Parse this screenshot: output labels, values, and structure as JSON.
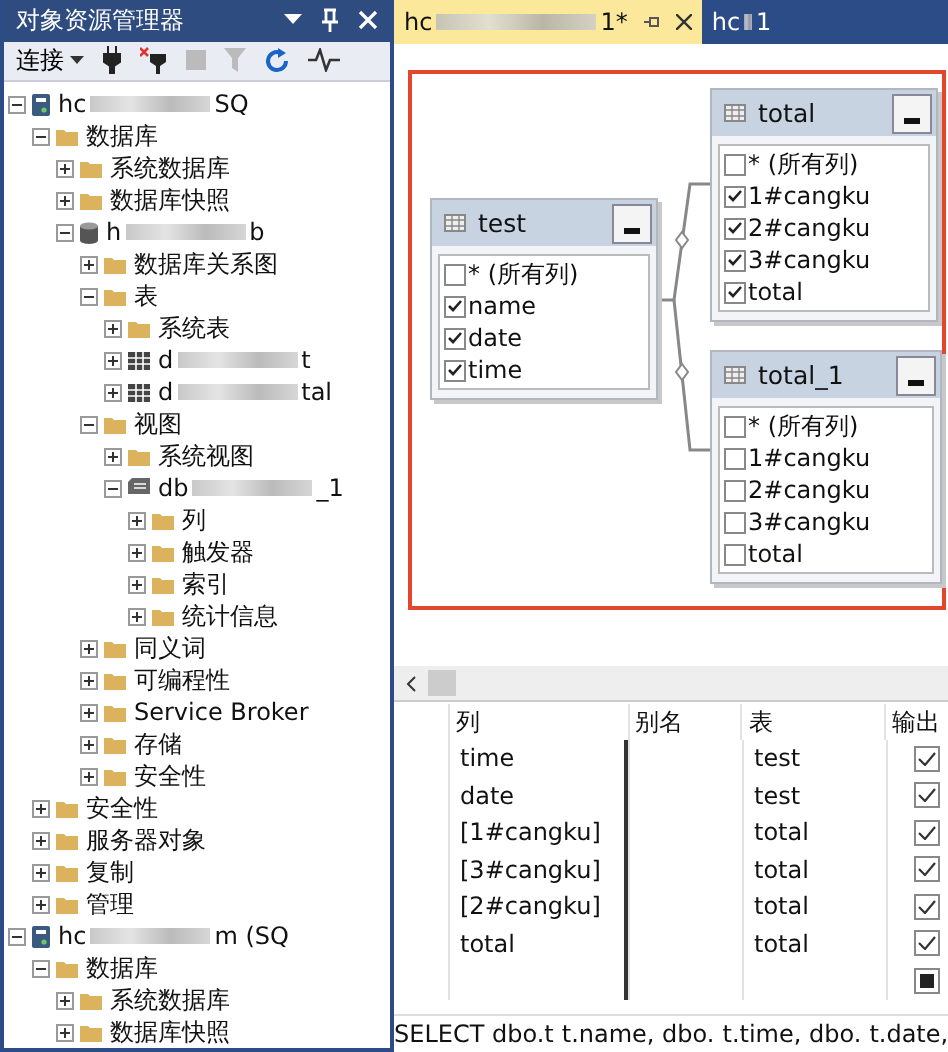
{
  "explorer": {
    "title": "对象资源管理器",
    "connect_label": "连接"
  },
  "tree": [
    {
      "kind": "server",
      "label": "hc",
      "redacted": true,
      "suffix": "SQ",
      "expanded": true,
      "children": [
        {
          "kind": "folder",
          "label": "数据库",
          "expanded": true,
          "children": [
            {
              "kind": "folder",
              "label": "系统数据库",
              "expanded": false
            },
            {
              "kind": "folder",
              "label": "数据库快照",
              "expanded": false
            },
            {
              "kind": "database",
              "label": "h",
              "redacted": true,
              "suffix": "b",
              "expanded": true,
              "children": [
                {
                  "kind": "folder",
                  "label": "数据库关系图",
                  "expanded": false
                },
                {
                  "kind": "folder",
                  "label": "表",
                  "expanded": true,
                  "children": [
                    {
                      "kind": "folder",
                      "label": "系统表",
                      "expanded": false
                    },
                    {
                      "kind": "table",
                      "label": "d",
                      "redacted": true,
                      "suffix": "t",
                      "expanded": false
                    },
                    {
                      "kind": "table",
                      "label": "d",
                      "redacted": true,
                      "suffix": "tal",
                      "expanded": false
                    }
                  ]
                },
                {
                  "kind": "folder",
                  "label": "视图",
                  "expanded": true,
                  "children": [
                    {
                      "kind": "folder",
                      "label": "系统视图",
                      "expanded": false
                    },
                    {
                      "kind": "view",
                      "label": "db",
                      "redacted": true,
                      "suffix": "_1",
                      "expanded": true,
                      "children": [
                        {
                          "kind": "folder",
                          "label": "列",
                          "expanded": false
                        },
                        {
                          "kind": "folder",
                          "label": "触发器",
                          "expanded": false
                        },
                        {
                          "kind": "folder",
                          "label": "索引",
                          "expanded": false
                        },
                        {
                          "kind": "folder",
                          "label": "统计信息",
                          "expanded": false
                        }
                      ]
                    }
                  ]
                },
                {
                  "kind": "folder",
                  "label": "同义词",
                  "expanded": false
                },
                {
                  "kind": "folder",
                  "label": "可编程性",
                  "expanded": false
                },
                {
                  "kind": "folder",
                  "label": "Service Broker",
                  "expanded": false
                },
                {
                  "kind": "folder",
                  "label": "存储",
                  "expanded": false
                },
                {
                  "kind": "folder",
                  "label": "安全性",
                  "expanded": false
                }
              ]
            }
          ]
        },
        {
          "kind": "folder",
          "label": "安全性",
          "expanded": false
        },
        {
          "kind": "folder",
          "label": "服务器对象",
          "expanded": false
        },
        {
          "kind": "folder",
          "label": "复制",
          "expanded": false
        },
        {
          "kind": "folder",
          "label": "管理",
          "expanded": false
        }
      ]
    },
    {
      "kind": "server",
      "label": "hc",
      "redacted": true,
      "suffix": "m (SQ",
      "expanded": true,
      "children": [
        {
          "kind": "folder",
          "label": "数据库",
          "expanded": true,
          "children": [
            {
              "kind": "folder",
              "label": "系统数据库",
              "expanded": false
            },
            {
              "kind": "folder",
              "label": "数据库快照",
              "expanded": false
            }
          ]
        }
      ]
    }
  ],
  "tabs": [
    {
      "label": "hc",
      "suffix": "1*",
      "selected": true
    },
    {
      "label": "hc",
      "suffix": "1",
      "selected": false
    }
  ],
  "diagram_tables": [
    {
      "name": "test",
      "columns": [
        {
          "name": "* (所有列)",
          "checked": false
        },
        {
          "name": "name",
          "checked": true
        },
        {
          "name": "date",
          "checked": true
        },
        {
          "name": "time",
          "checked": true
        }
      ]
    },
    {
      "name": "total",
      "columns": [
        {
          "name": "* (所有列)",
          "checked": false
        },
        {
          "name": "1#cangku",
          "checked": true
        },
        {
          "name": "2#cangku",
          "checked": true
        },
        {
          "name": "3#cangku",
          "checked": true
        },
        {
          "name": "total",
          "checked": true
        }
      ]
    },
    {
      "name": "total_1",
      "columns": [
        {
          "name": "* (所有列)",
          "checked": false
        },
        {
          "name": "1#cangku",
          "checked": false
        },
        {
          "name": "2#cangku",
          "checked": false
        },
        {
          "name": "3#cangku",
          "checked": false
        },
        {
          "name": "total",
          "checked": false
        }
      ]
    }
  ],
  "grid": {
    "columns": [
      "列",
      "别名",
      "表",
      "输出"
    ],
    "rows": [
      {
        "column": "time",
        "table": "test",
        "checked": true
      },
      {
        "column": "date",
        "table": "test",
        "checked": true
      },
      {
        "column": "[1#cangku]",
        "table": "total",
        "checked": true
      },
      {
        "column": "[3#cangku]",
        "table": "total",
        "checked": true
      },
      {
        "column": "[2#cangku]",
        "table": "total",
        "checked": true
      },
      {
        "column": "total",
        "table": "total",
        "checked": true
      },
      {
        "checked": false,
        "indeterminate": true
      }
    ]
  },
  "sql": {
    "parts": [
      "SELECT  dbo.t",
      "t.name, dbo.",
      "t.time, dbo.",
      "t.date,"
    ]
  }
}
